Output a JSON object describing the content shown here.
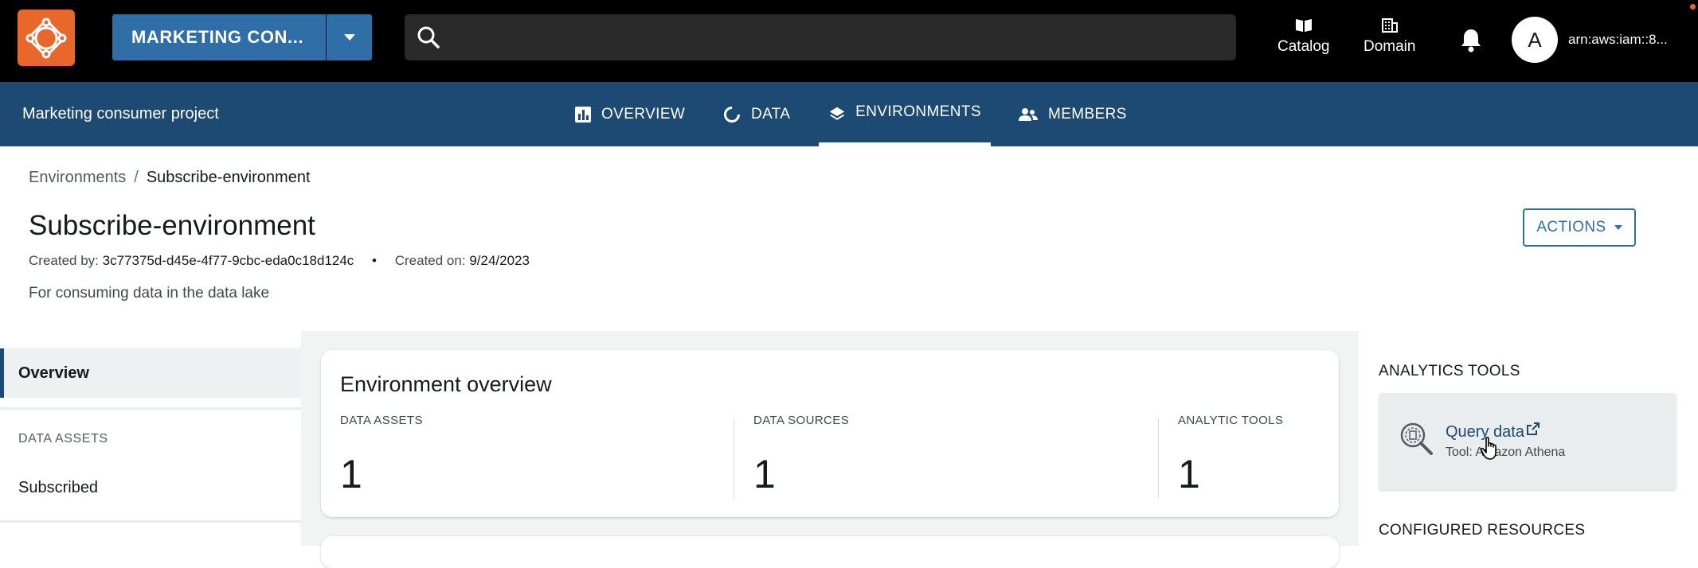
{
  "topbar": {
    "project_button": "MARKETING CON...",
    "search_placeholder": "",
    "catalog_label": "Catalog",
    "domain_label": "Domain",
    "avatar_letter": "A",
    "arn": "arn:aws:iam::8..."
  },
  "subnav": {
    "project_name": "Marketing consumer project",
    "tabs": [
      {
        "label": "OVERVIEW",
        "icon": "bar-chart-icon"
      },
      {
        "label": "DATA",
        "icon": "circle-progress-icon"
      },
      {
        "label": "ENVIRONMENTS",
        "icon": "layers-icon",
        "active": true
      },
      {
        "label": "MEMBERS",
        "icon": "people-icon"
      }
    ]
  },
  "header": {
    "breadcrumb_root": "Environments",
    "breadcrumb_separator": "/",
    "breadcrumb_current": "Subscribe-environment",
    "title": "Subscribe-environment",
    "created_by_label": "Created by:",
    "created_by_value": "3c77375d-d45e-4f77-9cbc-eda0c18d124c",
    "created_on_label": "Created on:",
    "created_on_value": "9/24/2023",
    "description": "For consuming data in the data lake",
    "actions_label": "ACTIONS"
  },
  "leftnav": {
    "overview": "Overview",
    "section_heading": "DATA ASSETS",
    "subscribed": "Subscribed"
  },
  "overview_card": {
    "title": "Environment overview",
    "stats": [
      {
        "label": "DATA ASSETS",
        "value": "1"
      },
      {
        "label": "DATA SOURCES",
        "value": "1"
      },
      {
        "label": "ANALYTIC TOOLS",
        "value": "1"
      }
    ]
  },
  "rightpanel": {
    "analytics_heading": "ANALYTICS TOOLS",
    "tool_link": "Query data",
    "tool_sub": "Tool: Amazon Athena",
    "configured_heading": "CONFIGURED RESOURCES"
  },
  "colors": {
    "topbar": "#000000",
    "subnav": "#1c4a72",
    "accent": "#2f6ea6",
    "logo": "#e8672a"
  }
}
